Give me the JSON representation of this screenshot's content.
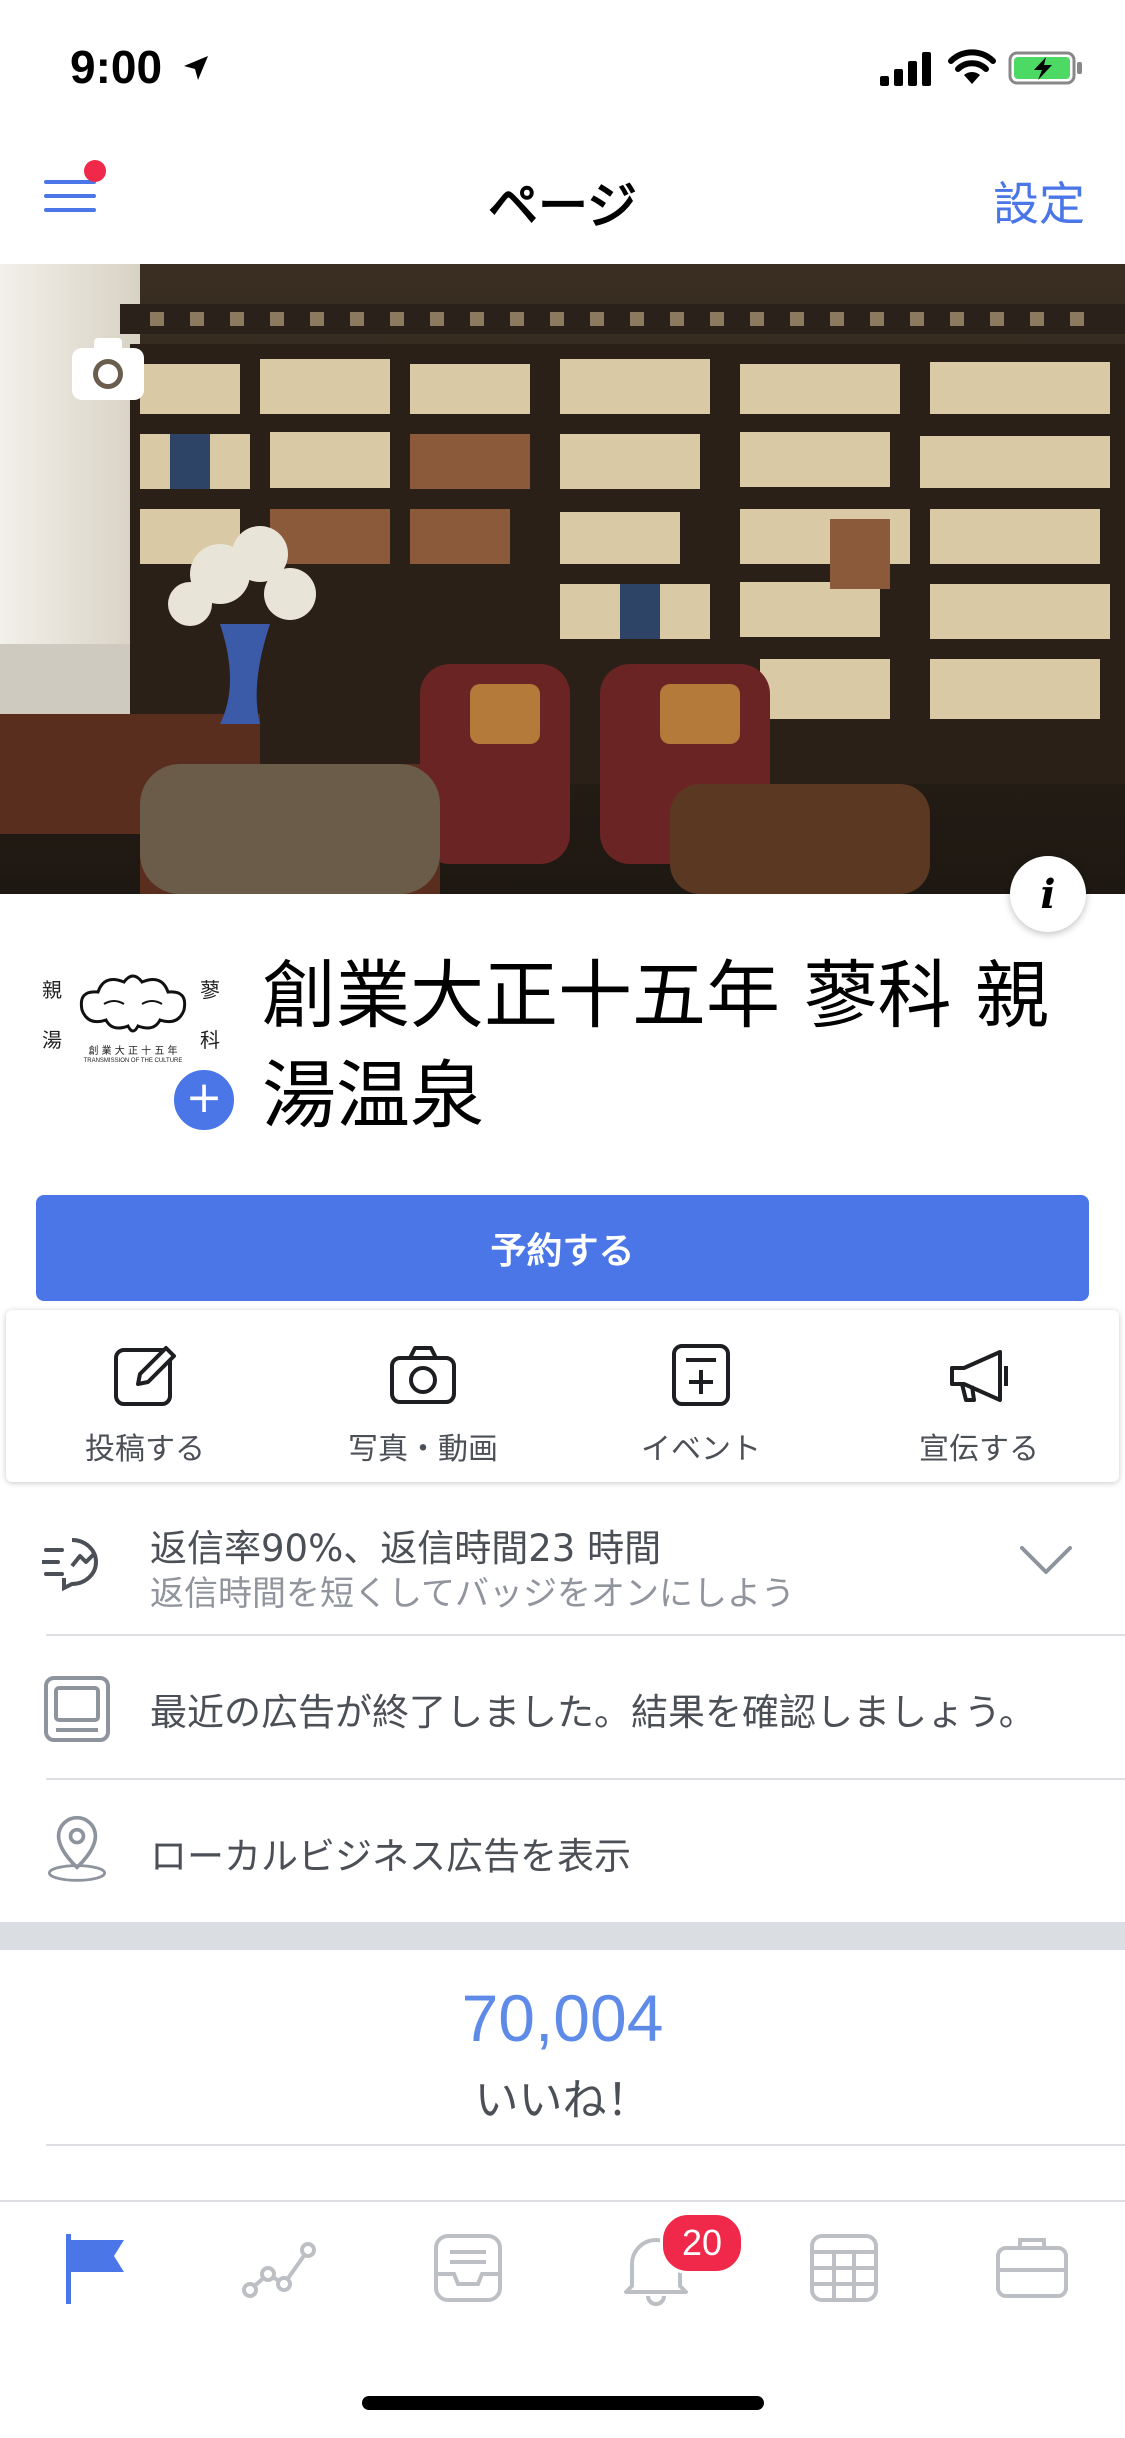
{
  "status_bar": {
    "time": "9:00"
  },
  "nav": {
    "title": "ページ",
    "settings_label": "設定"
  },
  "page": {
    "name": "創業大正十五年 蓼科 親湯温泉",
    "reserve_label": "予約する"
  },
  "logo": {
    "char_left_top": "親",
    "char_left_bottom": "湯",
    "char_right_top": "蓼",
    "char_right_bottom": "科",
    "sub_jp": "創 業 大 正 十 五 年",
    "sub_en": "TRANSMISSION OF THE CULTURE"
  },
  "actions": [
    {
      "label": "投稿する",
      "icon": "edit-icon"
    },
    {
      "label": "写真・動画",
      "icon": "camera-icon"
    },
    {
      "label": "イベント",
      "icon": "event-icon"
    },
    {
      "label": "宣伝する",
      "icon": "megaphone-icon"
    }
  ],
  "info_rows": {
    "response": {
      "title": "返信率90%、返信時間23 時間",
      "subtitle": "返信時間を短くしてバッジをオンにしよう"
    },
    "ads": {
      "title": "最近の広告が終了しました。結果を確認しましょう。"
    },
    "local": {
      "title": "ローカルビジネス広告を表示"
    }
  },
  "likes": {
    "count": "70,004",
    "label": "いいね！"
  },
  "tabs": {
    "items": [
      "flag-icon",
      "insights-icon",
      "inbox-icon",
      "bell-icon",
      "calendar-icon",
      "briefcase-icon"
    ],
    "notification_badge": "20"
  },
  "colors": {
    "accent": "#4a76e8",
    "badge": "#f02849",
    "divider": "#dddfe2"
  }
}
